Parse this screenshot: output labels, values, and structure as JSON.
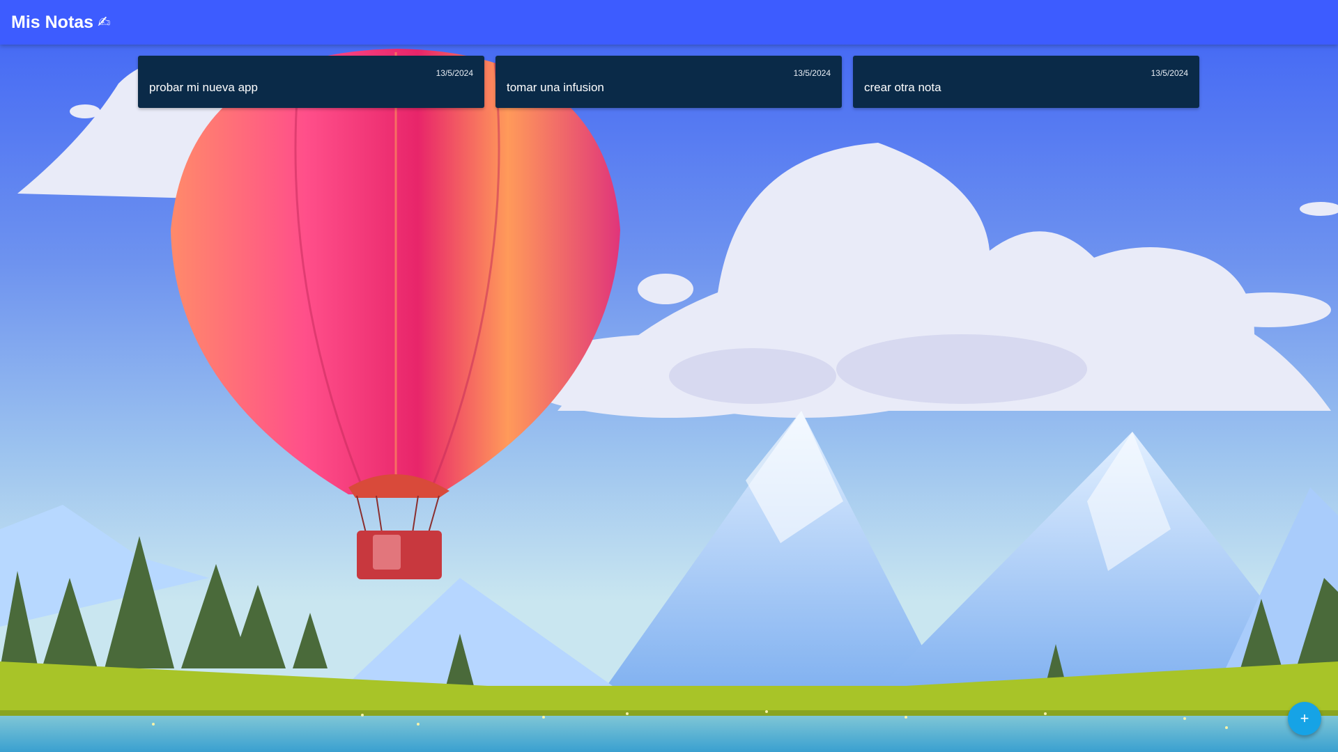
{
  "app": {
    "title": "Mis Notas",
    "title_icon": "✍"
  },
  "notes": [
    {
      "date": "13/5/2024",
      "text": "probar mi nueva app"
    },
    {
      "date": "13/5/2024",
      "text": "tomar una infusion"
    },
    {
      "date": "13/5/2024",
      "text": "crear otra nota"
    }
  ],
  "fab": {
    "label": "+",
    "icon": "plus-icon"
  },
  "colors": {
    "header": "#3d5cff",
    "note_card": "#0a2a48",
    "fab": "#16a3e6"
  }
}
